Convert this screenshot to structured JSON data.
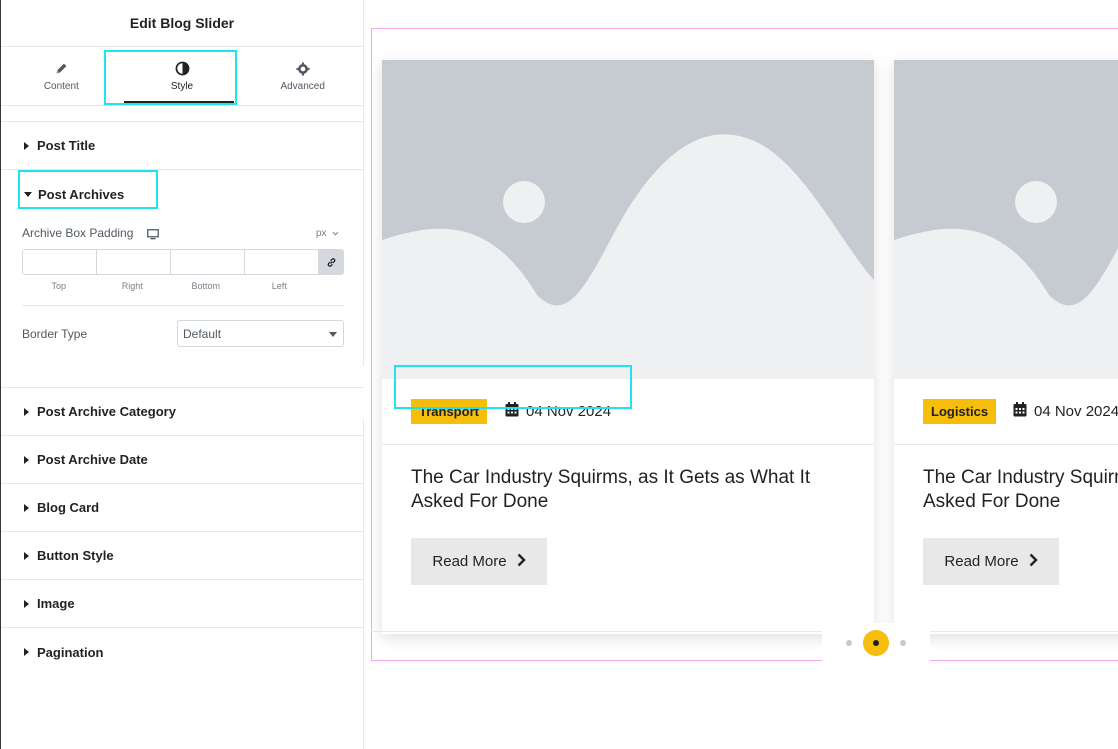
{
  "sidebar": {
    "title": "Edit Blog Slider",
    "tabs": [
      {
        "label": "Content",
        "icon": "pencil-icon"
      },
      {
        "label": "Style",
        "icon": "half-circle-icon"
      },
      {
        "label": "Advanced",
        "icon": "gear-icon"
      }
    ],
    "active_tab": "Style",
    "sections": {
      "post_title": "Post Title",
      "post_archives": "Post Archives",
      "post_archive_category": "Post Archive Category",
      "post_archive_date": "Post Archive Date",
      "blog_card": "Blog Card",
      "button_style": "Button Style",
      "image": "Image",
      "pagination": "Pagination"
    },
    "archives": {
      "padding_label": "Archive Box Padding",
      "unit": "px",
      "dimension_labels": [
        "Top",
        "Right",
        "Bottom",
        "Left"
      ],
      "border_type_label": "Border Type",
      "border_type_value": "Default"
    }
  },
  "canvas": {
    "cards": [
      {
        "category": "Transport",
        "date": "04 Nov 2024",
        "title": "The Car Industry Squirms, as It Gets as What It Asked For Done",
        "button": "Read More"
      },
      {
        "category": "Logistics",
        "date": "04 Nov 2024",
        "title": "The Car Industry Squirms, as It Gets as What It Asked For Done",
        "button": "Read More"
      }
    ],
    "pagination": {
      "total": 3,
      "active": 2
    }
  },
  "colors": {
    "accent": "#f6bd0a",
    "highlight": "#20e3f0",
    "frame": "#f1a7f1",
    "placeholder_bg": "#c5cbd1"
  }
}
